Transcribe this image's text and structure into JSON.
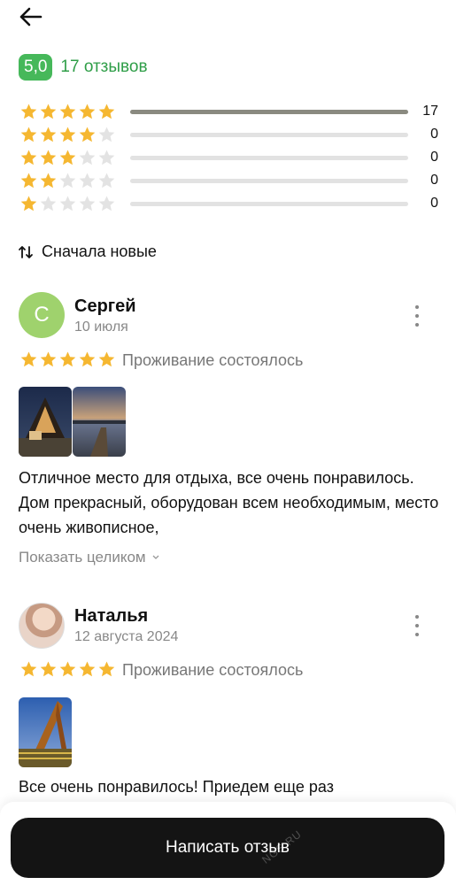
{
  "header": {
    "back_icon": "arrow-left-icon"
  },
  "summary": {
    "score": "5,0",
    "reviews_count_label": "17 отзывов",
    "accent_color": "#46b85a",
    "link_color": "#2f9e48"
  },
  "distribution": [
    {
      "stars": 5,
      "count": "17",
      "fraction": 1.0
    },
    {
      "stars": 4,
      "count": "0",
      "fraction": 0
    },
    {
      "stars": 3,
      "count": "0",
      "fraction": 0
    },
    {
      "stars": 2,
      "count": "0",
      "fraction": 0
    },
    {
      "stars": 1,
      "count": "0",
      "fraction": 0
    }
  ],
  "sort": {
    "icon": "sort-arrows-icon",
    "label": "Сначала новые"
  },
  "reviews": [
    {
      "avatar_letter": "С",
      "author": "Сергей",
      "date": "10 июля",
      "rating": 5,
      "stay_label": "Проживание состоялось",
      "text": "Отличное место для отдыха, все очень понравилось. Дом прекрасный, оборудован всем необходимым, место очень живописное,",
      "show_more": "Показать целиком"
    },
    {
      "author": "Наталья",
      "date": "12 августа 2024",
      "rating": 5,
      "stay_label": "Проживание состоялось",
      "text": "Все очень понравилось! Приедем еще раз"
    }
  ],
  "footer": {
    "write_review_label": "Написать отзыв",
    "watermark": "NGS.RU"
  },
  "colors": {
    "star_filled": "#f5b731",
    "star_empty": "#e3e3e3"
  }
}
